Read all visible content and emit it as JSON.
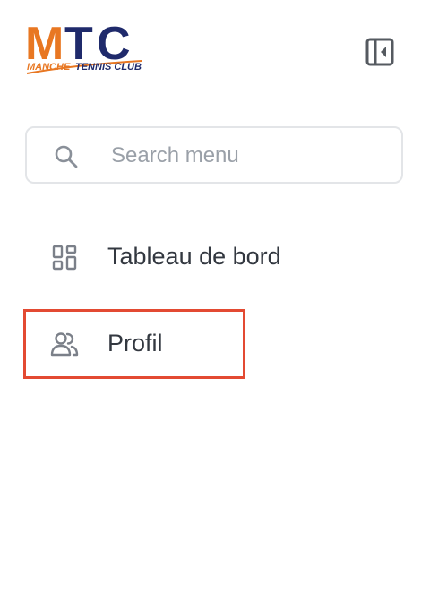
{
  "logo": {
    "letters": "MTC",
    "tagline_part1": "MANCHE",
    "tagline_part2": "TENNIS CLUB",
    "colors": {
      "orange": "#e87722",
      "navy": "#1f2a6b"
    }
  },
  "sidebar": {
    "collapse_icon": "sidebar-collapse-icon",
    "search": {
      "icon": "search-icon",
      "placeholder": "Search menu",
      "value": ""
    },
    "items": [
      {
        "label": "Tableau de bord",
        "icon": "dashboard-grid-icon"
      },
      {
        "label": "Profil",
        "icon": "users-icon",
        "highlighted": true
      }
    ],
    "highlight_color": "#e34a32"
  }
}
